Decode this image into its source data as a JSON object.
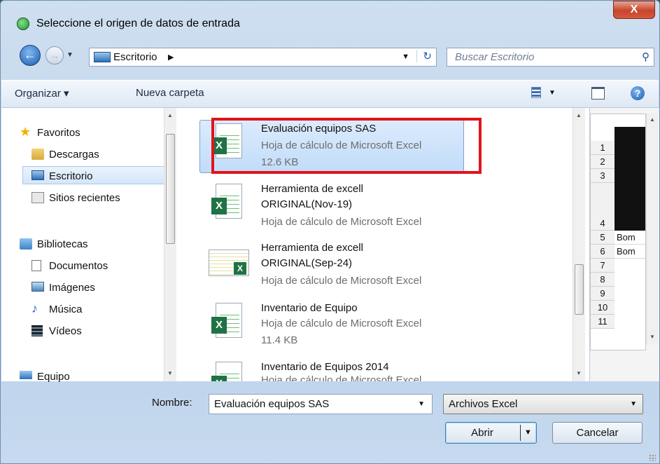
{
  "dialog": {
    "title": "Seleccione el origen de datos de entrada",
    "close_label": "X"
  },
  "navigation": {
    "back_icon": "back-arrow-icon",
    "forward_icon": "forward-arrow-icon",
    "address_crumb": "Escritorio",
    "search_placeholder": "Buscar Escritorio"
  },
  "toolbar": {
    "organize_label": "Organizar ▾",
    "new_folder_label": "Nueva carpeta"
  },
  "sidebar": {
    "favorites": "Favoritos",
    "items_fav": [
      "Descargas",
      "Escritorio",
      "Sitios recientes"
    ],
    "libraries": "Bibliotecas",
    "items_lib": [
      "Documentos",
      "Imágenes",
      "Música",
      "Vídeos"
    ],
    "computer": "Equipo",
    "selected": "Escritorio"
  },
  "files": [
    {
      "name": "Evaluación equipos SAS",
      "type": "Hoja de cálculo de Microsoft Excel",
      "size": "12.6 KB",
      "selected": true
    },
    {
      "name": "Herramienta de excell\nORIGINAL(Nov-19)",
      "type": "Hoja de cálculo de Microsoft Excel",
      "size": ""
    },
    {
      "name": "Herramienta de excell\nORIGINAL(Sep-24)",
      "type": "Hoja de cálculo de Microsoft Excel",
      "size": ""
    },
    {
      "name": "Inventario de Equipo",
      "type": "Hoja de cálculo de Microsoft Excel",
      "size": "11.4 KB"
    },
    {
      "name": "Inventario de Equipos 2014",
      "type": "Hoja de cálculo de Microsoft Excel",
      "size": ""
    }
  ],
  "preview": {
    "rows": [
      "1",
      "2",
      "3",
      "4",
      "5",
      "6",
      "7",
      "8",
      "9",
      "10",
      "11"
    ],
    "cells": {
      "5": "Bom",
      "6": "Bom"
    }
  },
  "footer": {
    "name_label": "Nombre:",
    "name_value": "Evaluación equipos SAS",
    "filter_value": "Archivos Excel",
    "open_label": "Abrir",
    "cancel_label": "Cancelar"
  },
  "highlight_color": "#e0141b"
}
